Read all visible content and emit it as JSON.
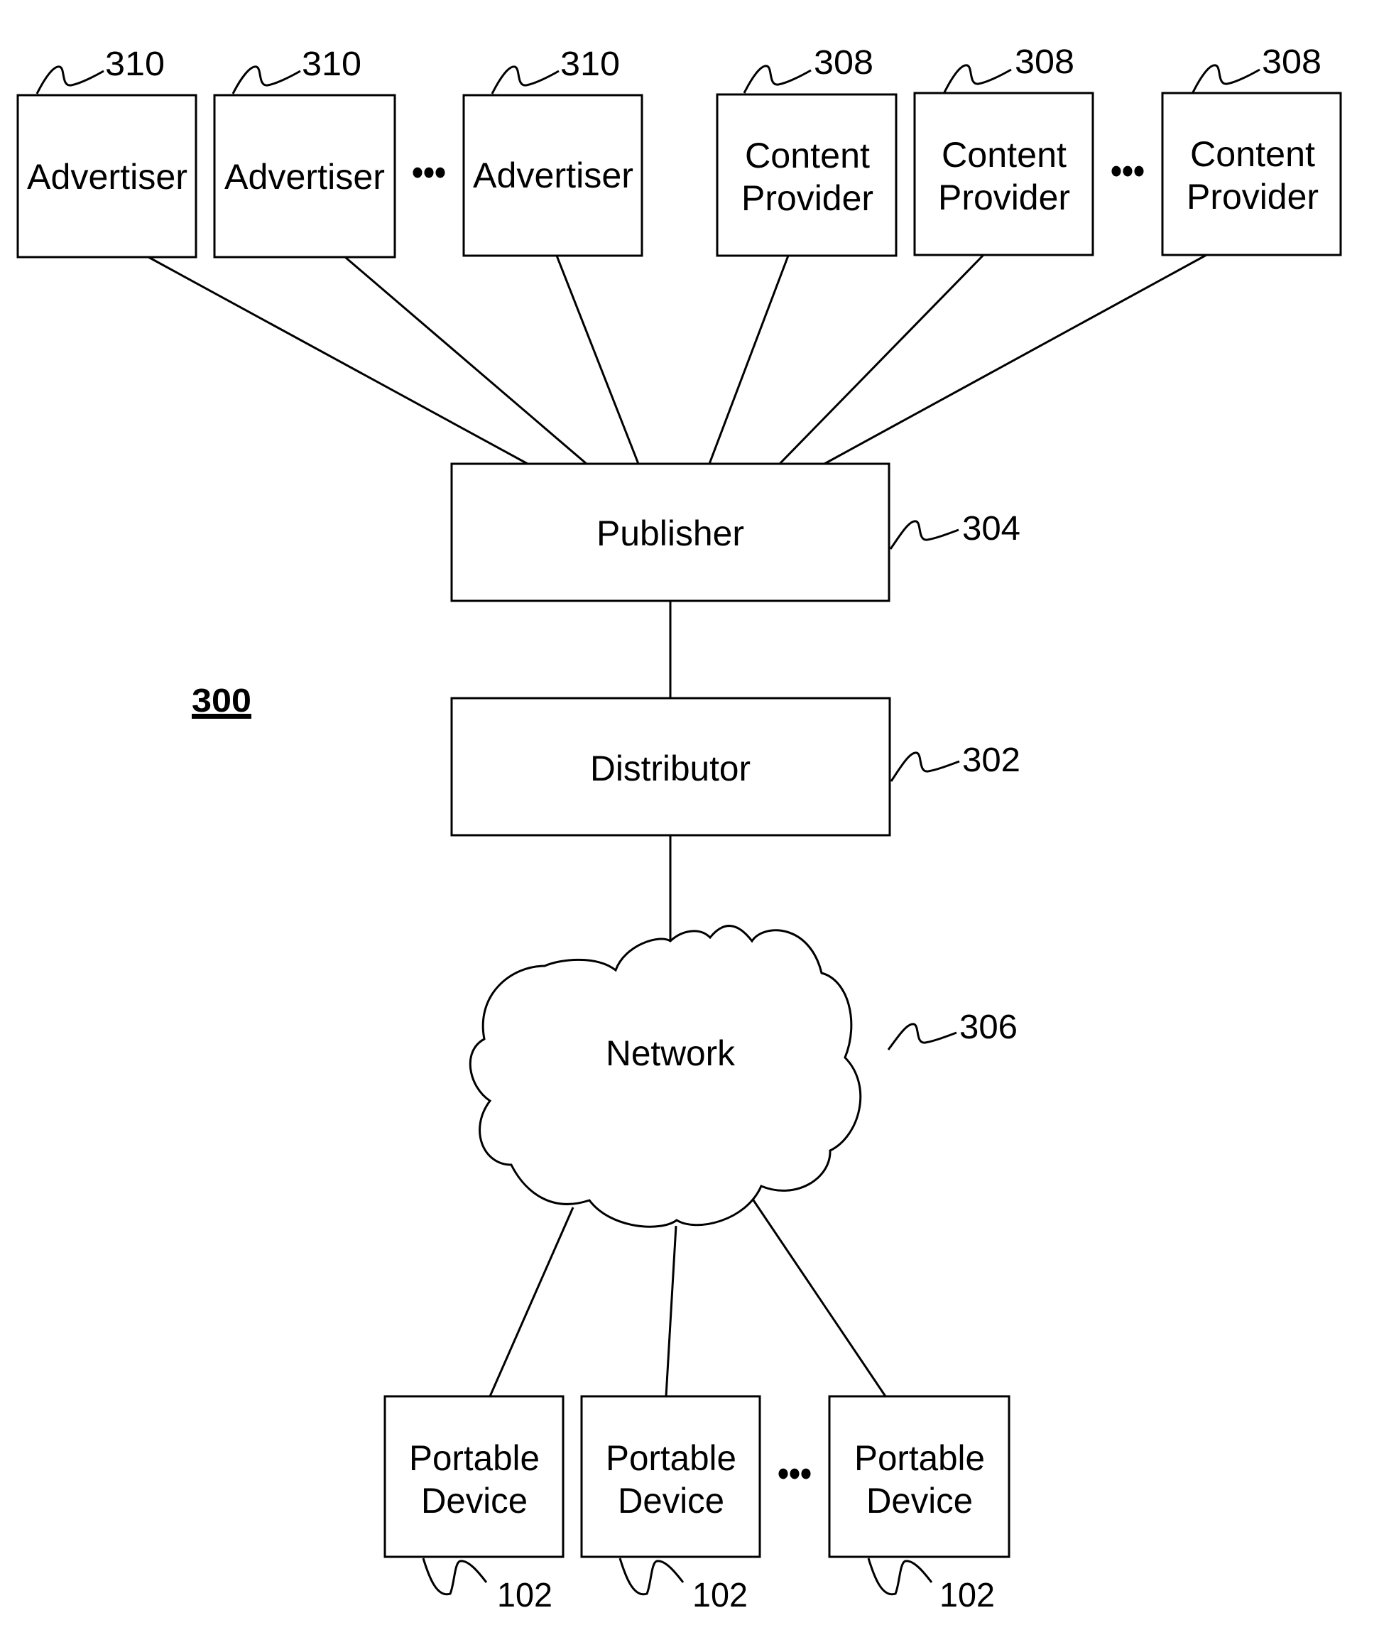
{
  "figure_label": "300",
  "advertisers": [
    {
      "label": "Advertiser",
      "ref": "310"
    },
    {
      "label": "Advertiser",
      "ref": "310"
    },
    {
      "label": "Advertiser",
      "ref": "310"
    }
  ],
  "content_providers": [
    {
      "line1": "Content",
      "line2": "Provider",
      "ref": "308"
    },
    {
      "line1": "Content",
      "line2": "Provider",
      "ref": "308"
    },
    {
      "line1": "Content",
      "line2": "Provider",
      "ref": "308"
    }
  ],
  "ellipsis": "•••",
  "publisher": {
    "label": "Publisher",
    "ref": "304"
  },
  "distributor": {
    "label": "Distributor",
    "ref": "302"
  },
  "network": {
    "label": "Network",
    "ref": "306"
  },
  "portable_devices": [
    {
      "line1": "Portable",
      "line2": "Device",
      "ref": "102"
    },
    {
      "line1": "Portable",
      "line2": "Device",
      "ref": "102"
    },
    {
      "line1": "Portable",
      "line2": "Device",
      "ref": "102"
    }
  ]
}
